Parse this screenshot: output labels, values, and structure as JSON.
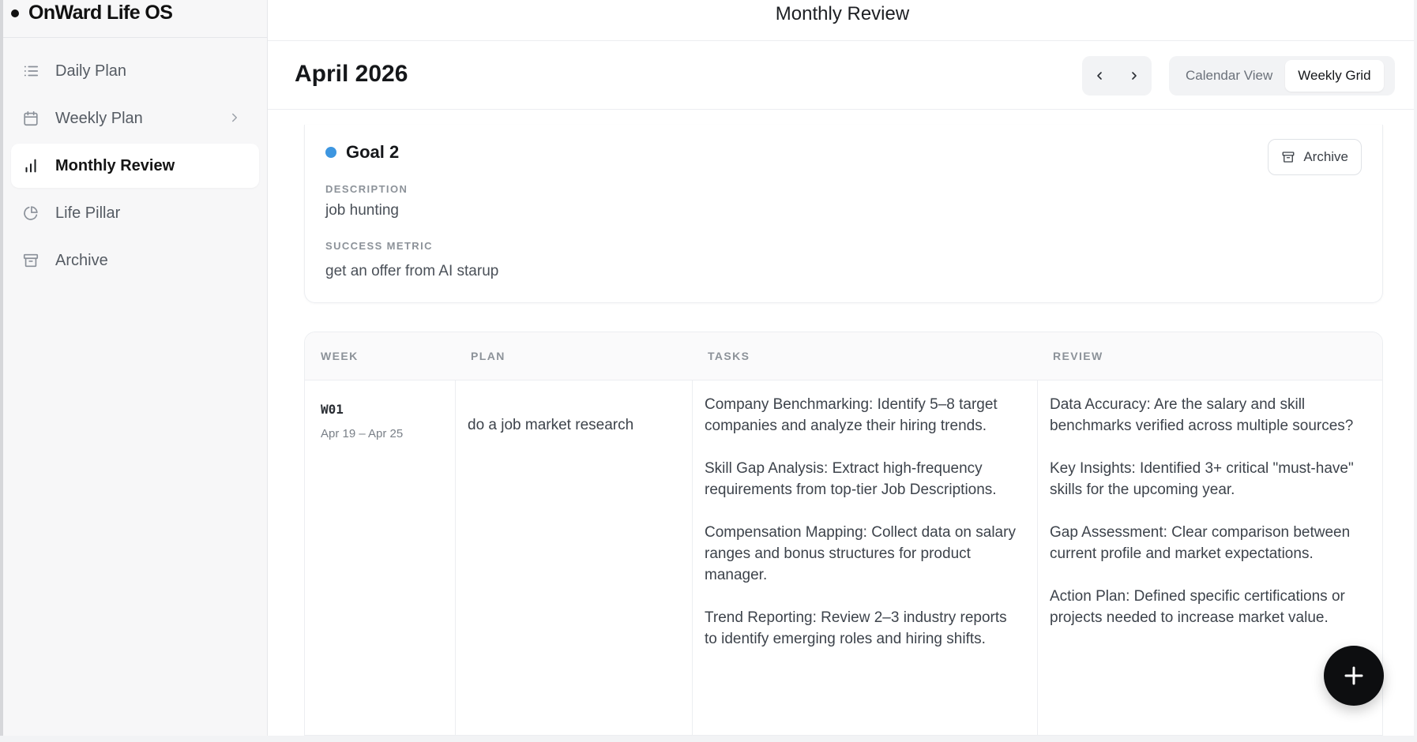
{
  "app": {
    "title": "OnWard Life OS"
  },
  "sidebar": {
    "items": [
      {
        "label": "Daily Plan",
        "icon": "list-icon"
      },
      {
        "label": "Weekly Plan",
        "icon": "calendar-icon"
      },
      {
        "label": "Monthly Review",
        "icon": "bar-chart-icon"
      },
      {
        "label": "Life Pillar",
        "icon": "pie-icon"
      },
      {
        "label": "Archive",
        "icon": "archive-icon"
      }
    ],
    "active": "Monthly Review"
  },
  "header": {
    "page_title": "Monthly Review",
    "month": "April 2026",
    "views": [
      "Calendar View",
      "Weekly Grid"
    ],
    "active_view": "Weekly Grid"
  },
  "goal": {
    "title": "Goal 2",
    "color": "#3d96e0",
    "archive_label": "Archive",
    "description_label": "DESCRIPTION",
    "description": "job hunting",
    "metric_label": "SUCCESS METRIC",
    "metric": "get an offer from AI starup"
  },
  "table": {
    "columns": [
      "WEEK",
      "PLAN",
      "TASKS",
      "REVIEW"
    ],
    "rows": [
      {
        "week": "W01",
        "range": "Apr 19 – Apr 25",
        "plan": "do a job market research",
        "tasks": [
          "Company Benchmarking: Identify 5–8 target companies and analyze their hiring trends.",
          "Skill Gap Analysis: Extract high-frequency requirements from top-tier Job Descriptions.",
          "Compensation Mapping: Collect data on salary ranges and bonus structures for product manager.",
          "Trend Reporting: Review 2–3 industry reports to identify emerging roles and hiring shifts."
        ],
        "review": [
          "Data Accuracy: Are the salary and skill benchmarks verified across multiple sources?",
          "Key Insights: Identified 3+ critical \"must-have\" skills for the upcoming year.",
          "Gap Assessment: Clear comparison between current profile and market expectations.",
          "Action Plan: Defined specific certifications or projects needed to increase market value."
        ]
      }
    ]
  }
}
